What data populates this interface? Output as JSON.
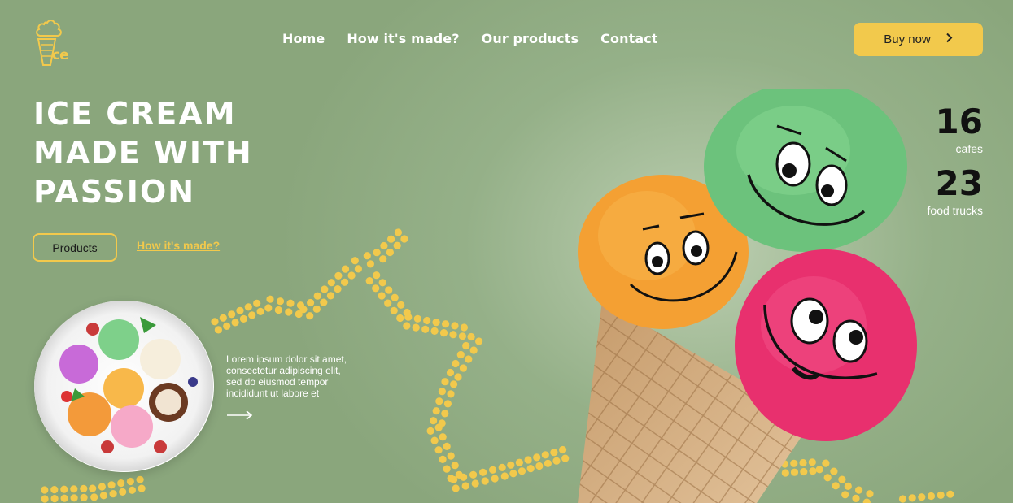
{
  "logo": {
    "text": "ce",
    "icon": "ice-cream-cone-icon"
  },
  "nav": {
    "items": [
      {
        "label": "Home"
      },
      {
        "label": "How it's made?"
      },
      {
        "label": "Our products"
      },
      {
        "label": "Contact"
      }
    ]
  },
  "header": {
    "buy_label": "Buy now",
    "buy_icon": "chevron-right-icon"
  },
  "hero": {
    "title_lines": [
      "ICE CREAM",
      "MADE WITH",
      "PASSION"
    ],
    "products_label": "Products",
    "how_label": "How it's made?"
  },
  "feature": {
    "lorem_lines": [
      "Lorem ipsum dolor sit amet,",
      "consectetur adipiscing elit,",
      "sed do eiusmod tempor",
      "incididunt ut labore et"
    ],
    "arrow_icon": "arrow-right-icon"
  },
  "stats": [
    {
      "value": "16",
      "label": "cafes"
    },
    {
      "value": "23",
      "label": "food trucks"
    }
  ],
  "colors": {
    "background": "#8aa67c",
    "accent_yellow": "#f2c94c",
    "text_white": "#ffffff",
    "text_dark": "#111111"
  }
}
